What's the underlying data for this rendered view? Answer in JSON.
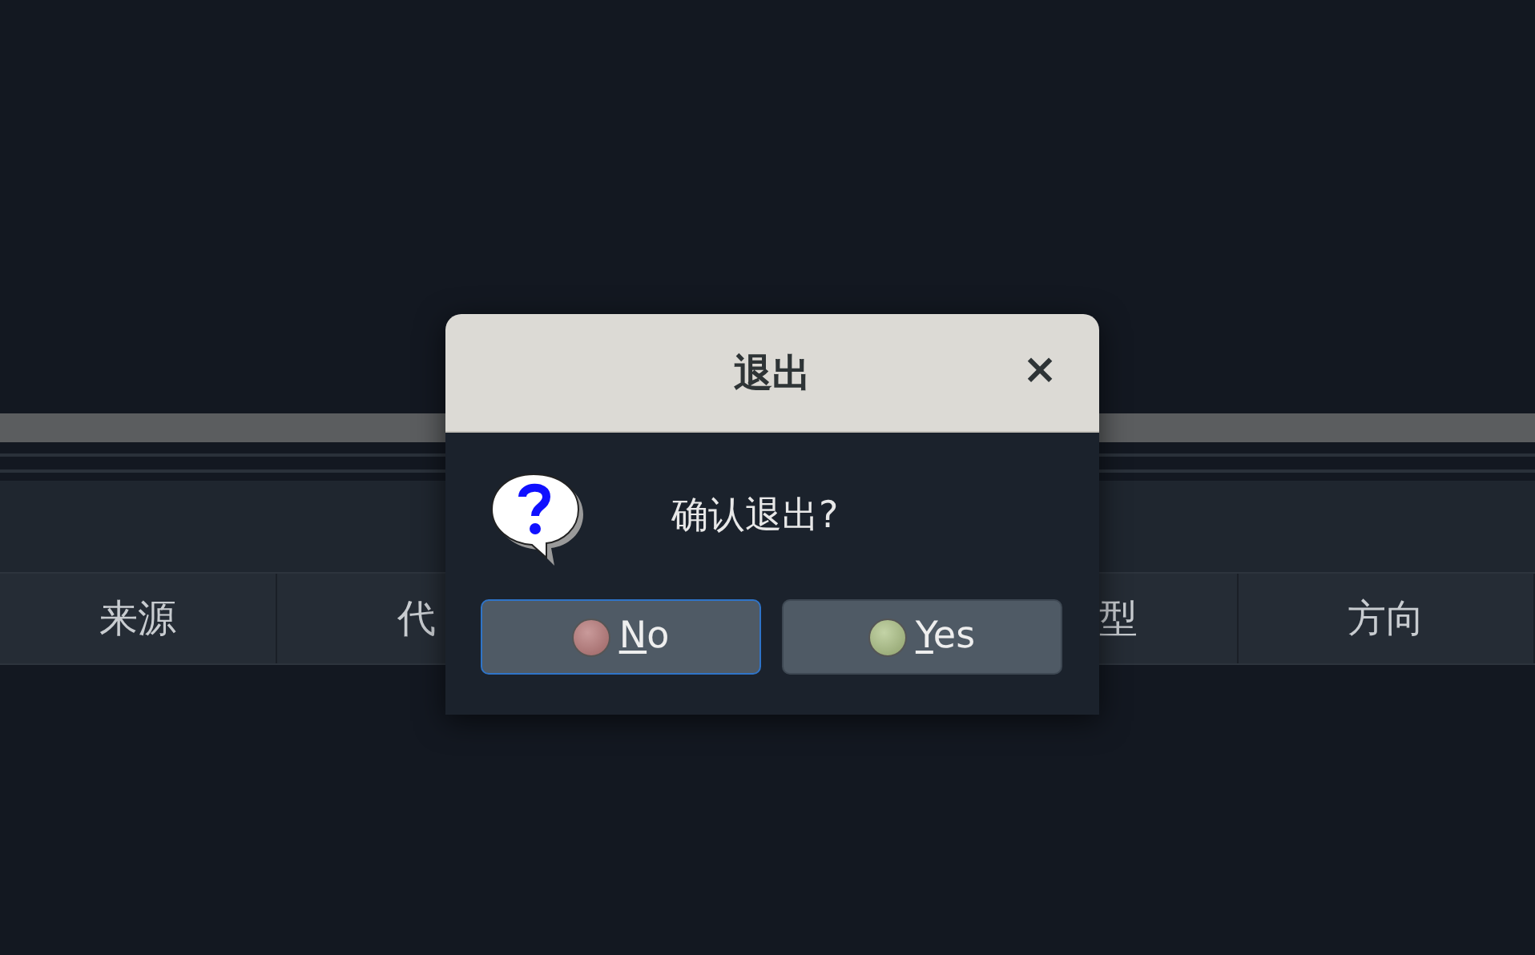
{
  "table": {
    "columns": [
      {
        "label": "来源"
      },
      {
        "label": "代"
      },
      {
        "label": "型"
      },
      {
        "label": "方向"
      }
    ]
  },
  "dialog": {
    "title": "退出",
    "close": "×",
    "message": "确认退出?",
    "buttons": [
      {
        "label": "No",
        "kind": "no",
        "focused": true,
        "mnemonic": true
      },
      {
        "label": "Yes",
        "kind": "yes",
        "focused": false,
        "mnemonic": true
      }
    ]
  }
}
